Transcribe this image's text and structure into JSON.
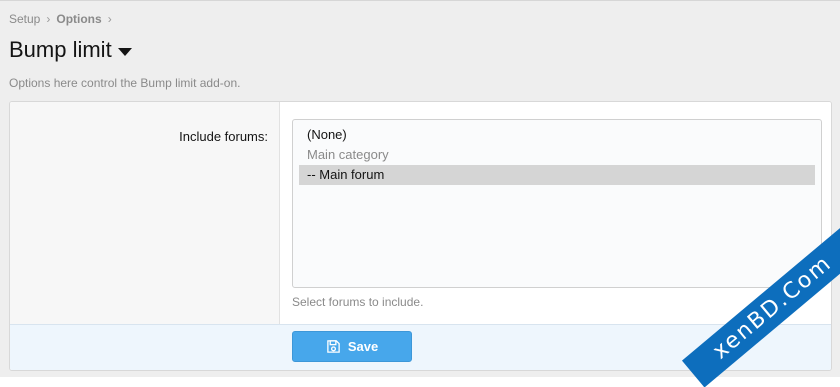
{
  "breadcrumb": {
    "items": [
      "Setup",
      "Options"
    ],
    "separator": "›"
  },
  "header": {
    "title": "Bump limit",
    "description": "Options here control the Bump limit add-on."
  },
  "form": {
    "include_forums": {
      "label": "Include forums:",
      "options": [
        {
          "label": "(None)",
          "type": "option",
          "selected": false
        },
        {
          "label": "Main category",
          "type": "group",
          "selected": false
        },
        {
          "label": "-- Main forum",
          "type": "option",
          "selected": true
        }
      ],
      "hint": "Select forums to include."
    },
    "save_label": "Save"
  },
  "watermark": {
    "text": "xenBD.Com"
  },
  "colors": {
    "accent": "#47a7eb",
    "watermark_bg": "#0d6ebd",
    "selected_option_bg": "#d5d5d5"
  },
  "icons": {
    "title_menu": "caret-down-icon",
    "save": "save-icon"
  }
}
